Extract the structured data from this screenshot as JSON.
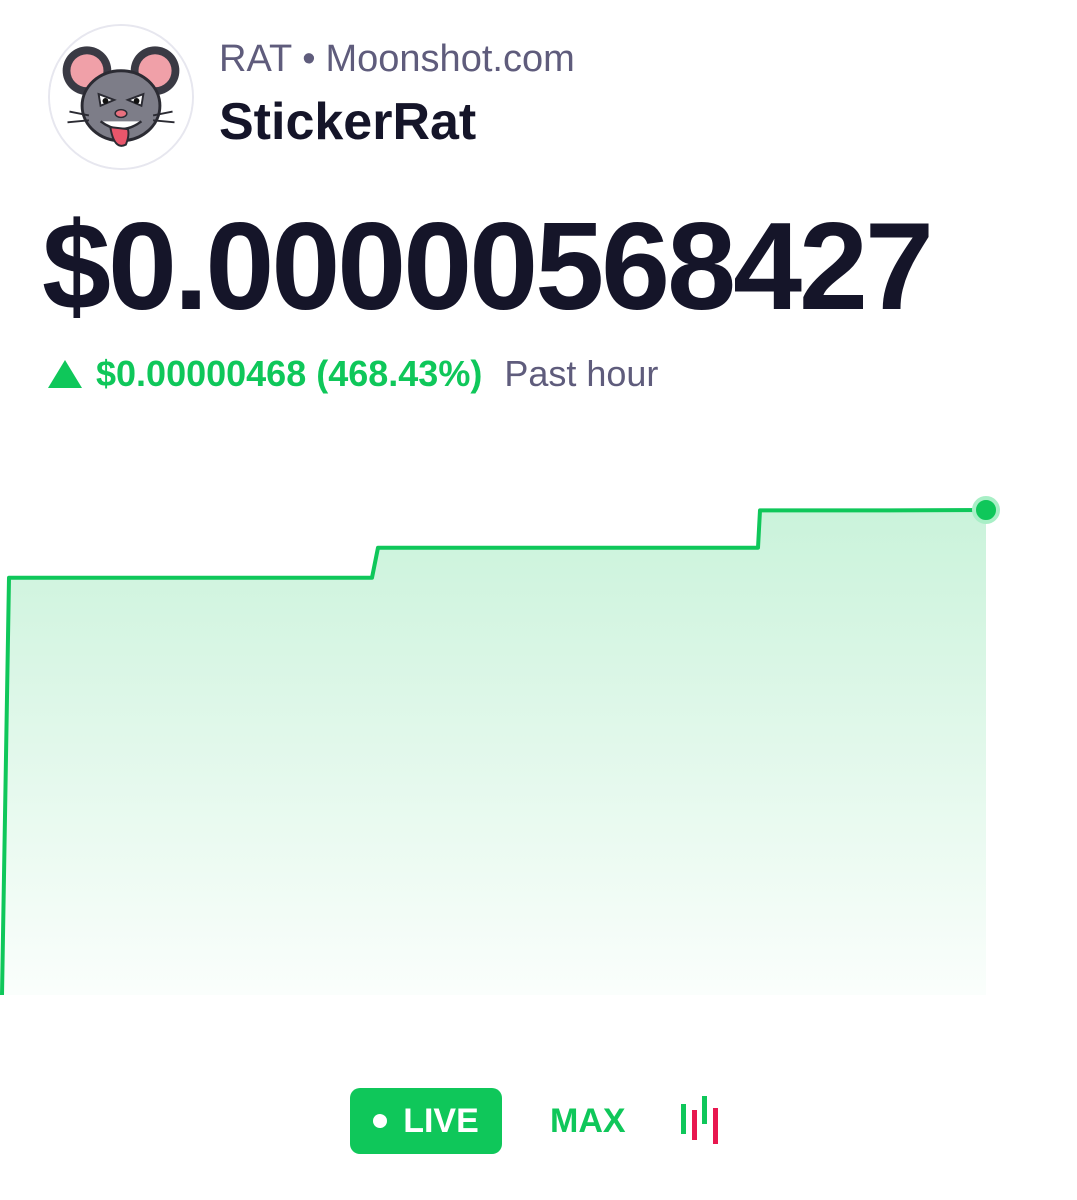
{
  "token": {
    "ticker": "RAT",
    "separator": "•",
    "source": "Moonshot.com",
    "name": "StickerRat",
    "avatar_icon": "rat-avatar-icon"
  },
  "price": {
    "current": "$0.00000568427",
    "change": "$0.00000468 (468.43%)",
    "period": "Past hour",
    "direction": "up",
    "color_up": "#0fc75a"
  },
  "chart_data": {
    "type": "area",
    "x": [
      0,
      1,
      2,
      3,
      4,
      5,
      6,
      7,
      8,
      9,
      10
    ],
    "values": [
      1e-06,
      5.03e-06,
      5.03e-06,
      5.03e-06,
      5.32e-06,
      5.32e-06,
      5.32e-06,
      5.32e-06,
      5.68e-06,
      5.68e-06,
      5.68427e-06
    ],
    "title": "",
    "xlabel": "",
    "ylabel": "",
    "grid": false,
    "legend": "none",
    "line_color": "#0fc75a"
  },
  "controls": {
    "live_label": "LIVE",
    "max_label": "MAX",
    "candles_icon": "candlestick-icon"
  }
}
